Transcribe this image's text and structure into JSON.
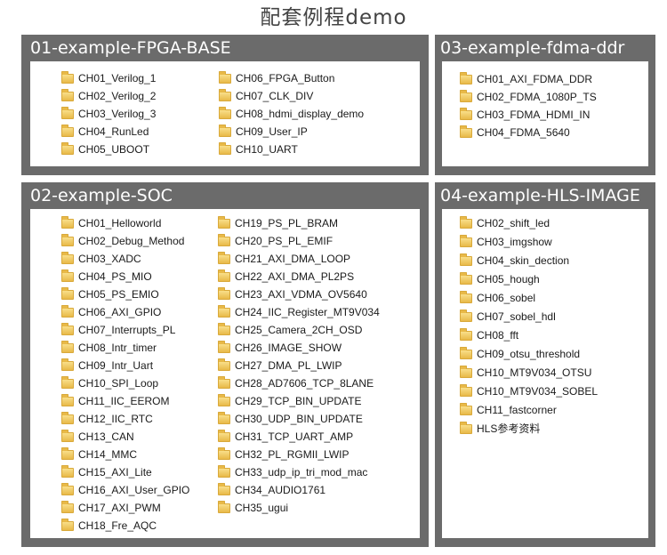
{
  "page_title": "配套例程demo",
  "panels": {
    "base": {
      "title": "01-example-FPGA-BASE",
      "col1": [
        "CH01_Verilog_1",
        "CH02_Verilog_2",
        "CH03_Verilog_3",
        "CH04_RunLed",
        "CH05_UBOOT"
      ],
      "col2": [
        "CH06_FPGA_Button",
        "CH07_CLK_DIV",
        "CH08_hdmi_display_demo",
        "CH09_User_IP",
        "CH10_UART"
      ]
    },
    "fdma": {
      "title": "03-example-fdma-ddr",
      "col1": [
        "CH01_AXI_FDMA_DDR",
        "CH02_FDMA_1080P_TS",
        "CH03_FDMA_HDMI_IN",
        "CH04_FDMA_5640"
      ]
    },
    "soc": {
      "title": "02-example-SOC",
      "col1": [
        "CH01_Helloworld",
        "CH02_Debug_Method",
        "CH03_XADC",
        "CH04_PS_MIO",
        "CH05_PS_EMIO",
        "CH06_AXI_GPIO",
        "CH07_Interrupts_PL",
        "CH08_Intr_timer",
        "CH09_Intr_Uart",
        "CH10_SPI_Loop",
        "CH11_IIC_EEROM",
        "CH12_IIC_RTC",
        "CH13_CAN",
        "CH14_MMC",
        "CH15_AXI_Lite",
        "CH16_AXI_User_GPIO",
        "CH17_AXI_PWM",
        "CH18_Fre_AQC"
      ],
      "col2": [
        "CH19_PS_PL_BRAM",
        "CH20_PS_PL_EMIF",
        "CH21_AXI_DMA_LOOP",
        "CH22_AXI_DMA_PL2PS",
        "CH23_AXI_VDMA_OV5640",
        "CH24_IIC_Register_MT9V034",
        "CH25_Camera_2CH_OSD",
        "CH26_IMAGE_SHOW",
        "CH27_DMA_PL_LWIP",
        "CH28_AD7606_TCP_8LANE",
        "CH29_TCP_BIN_UPDATE",
        "CH30_UDP_BIN_UPDATE",
        "CH31_TCP_UART_AMP",
        "CH32_PL_RGMII_LWIP",
        "CH33_udp_ip_tri_mod_mac",
        "CH34_AUDIO1761",
        "CH35_ugui"
      ]
    },
    "hls": {
      "title": "04-example-HLS-IMAGE",
      "col1": [
        "CH02_shift_led",
        "CH03_imgshow",
        "CH04_skin_dection",
        "CH05_hough",
        "CH06_sobel",
        "CH07_sobel_hdl",
        "CH08_fft",
        "CH09_otsu_threshold",
        "CH10_MT9V034_OTSU",
        "CH10_MT9V034_SOBEL",
        "CH11_fastcorner",
        "HLS参考资料"
      ]
    }
  },
  "colors": {
    "panel_bg": "#6b6b6b",
    "folder": "#e8b948",
    "title_text": "#444444"
  },
  "icons": {
    "folder": "folder-icon"
  }
}
